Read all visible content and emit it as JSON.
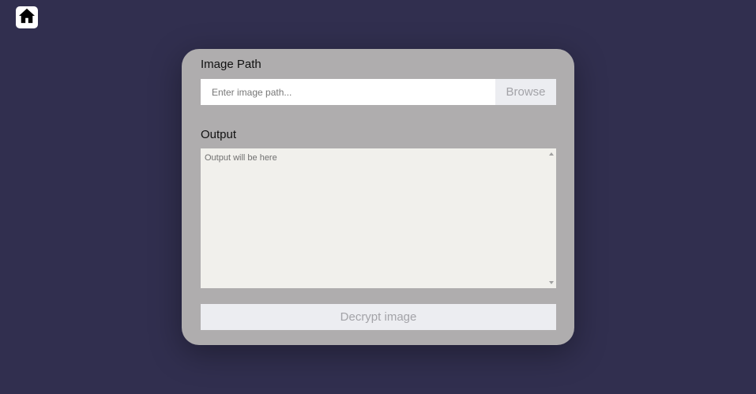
{
  "nav": {
    "home_icon": "home-icon"
  },
  "form": {
    "image_path_label": "Image Path",
    "image_path_placeholder": "Enter image path...",
    "image_path_value": "",
    "browse_label": "Browse",
    "output_label": "Output",
    "output_placeholder": "Output will be here",
    "output_value": "",
    "decrypt_label": "Decrypt image"
  },
  "colors": {
    "background": "#312f4f",
    "card": "#afadae",
    "button_bg": "#ecedf1",
    "button_text": "#a3a3a8",
    "output_bg": "#f1f0ec"
  }
}
